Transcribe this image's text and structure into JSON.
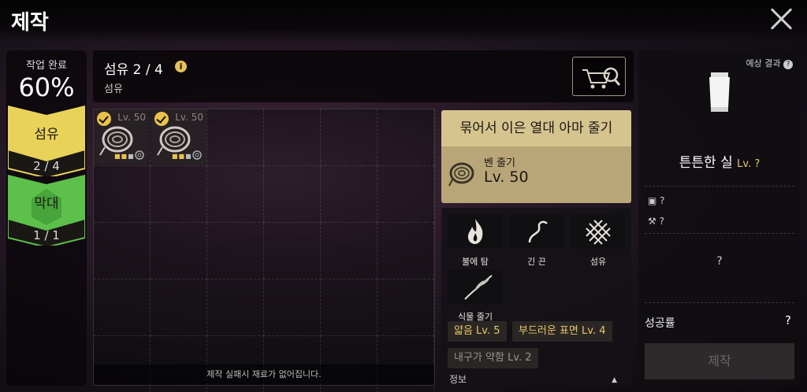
{
  "window": {
    "title": "제작"
  },
  "steps": {
    "progress_label": "작업 완료",
    "progress_value": "60%",
    "items": [
      {
        "name": "섬유",
        "count": "2 / 4",
        "color": "#e8d25a",
        "state": "active"
      },
      {
        "name": "막대",
        "count": "1 / 1",
        "color": "#5cc04a",
        "state": "complete"
      }
    ]
  },
  "material": {
    "title": "섬유 2 / 4",
    "subtitle": "섬유",
    "info_icon": "info-icon",
    "shop_icon": "cart-search-icon"
  },
  "inventory": {
    "slots": [
      {
        "level": "Lv. 50",
        "checked": true,
        "icon": "fiber-bundle-icon"
      },
      {
        "level": "Lv. 50",
        "checked": true,
        "icon": "fiber-bundle-icon"
      }
    ],
    "footer_note": "제작 실패시 재료가 없어집니다."
  },
  "detail": {
    "title": "묶어서 이은 열대 아마 줄기",
    "sub": "벤 줄기",
    "level": "Lv. 50",
    "attributes": [
      {
        "label": "불에 탐",
        "icon": "flame-icon"
      },
      {
        "label": "긴 끈",
        "icon": "string-icon"
      },
      {
        "label": "섬유",
        "icon": "weave-icon"
      },
      {
        "label": "식물 줄기",
        "icon": "plant-stem-icon"
      }
    ],
    "traits": [
      {
        "label": "얇음 Lv. 5",
        "tone": "gold"
      },
      {
        "label": "부드러운 표면 Lv. 4",
        "tone": "gold"
      },
      {
        "label": "내구가 약함 Lv. 2",
        "tone": "gray"
      }
    ],
    "info_label": "정보"
  },
  "result": {
    "label": "예상 결과",
    "name": "튼튼한 실",
    "level": "Lv. ?",
    "stats": [
      {
        "icon": "box-icon",
        "value": "?"
      },
      {
        "icon": "hammer-icon",
        "value": "?"
      }
    ],
    "mystery": "?",
    "success_label": "성공률",
    "success_value": "?",
    "craft_label": "제작"
  }
}
